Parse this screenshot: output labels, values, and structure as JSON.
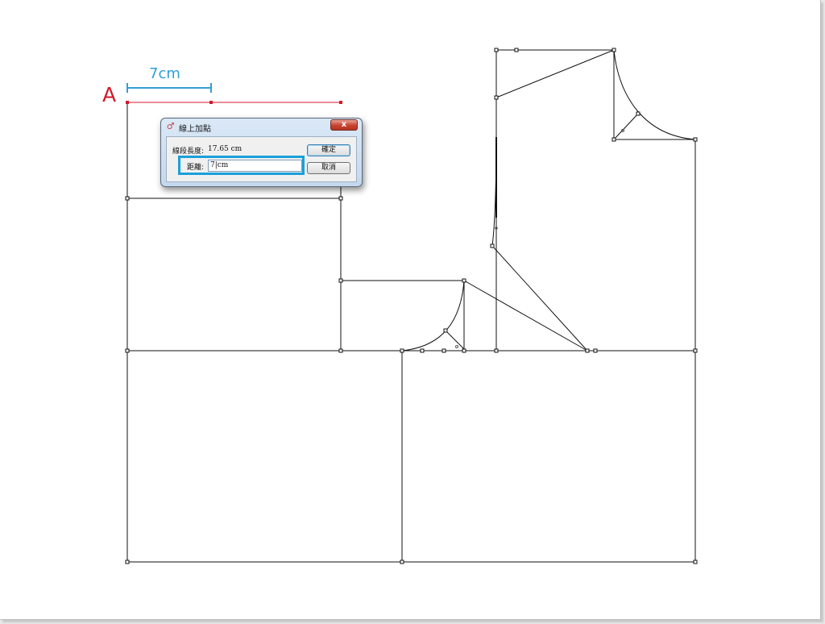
{
  "annotations": {
    "point_label": "A",
    "measure_label": "7cm"
  },
  "dialog": {
    "title": "線上加點",
    "segment_length_label": "線段長度:",
    "segment_length_value": "17.65 cm",
    "distance_label": "距離:",
    "distance_value": "7|cm",
    "ok_label": "確定",
    "cancel_label": "取消",
    "close_glyph": "x"
  },
  "colors": {
    "accent_red": "#d0192b",
    "accent_blue": "#2f9fd7",
    "highlight_blue": "#1aa0d8",
    "line": "#111111"
  },
  "icons": {
    "app": "app-icon",
    "close": "close-icon"
  }
}
